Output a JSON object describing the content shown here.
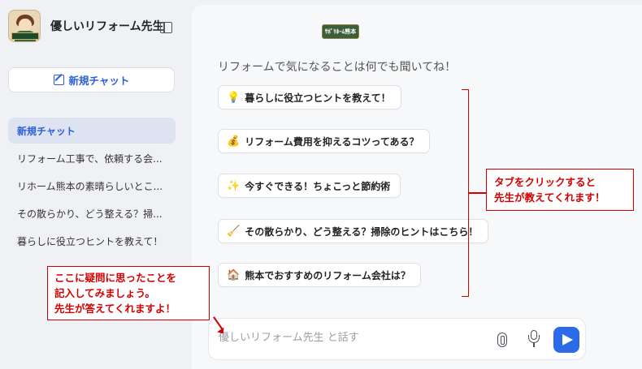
{
  "sidebar": {
    "title": "優しいリフォーム先生",
    "new_chat_label": "新規チャット",
    "history": [
      {
        "label": "新規チャット",
        "active": true
      },
      {
        "label": "リフォーム工事で、依頼する会..."
      },
      {
        "label": "リホーム熊本の素晴らしいとこ..."
      },
      {
        "label": "その散らかり、どう整える？掃..."
      },
      {
        "label": "暮らしに役立つヒントを教えて！"
      }
    ]
  },
  "main": {
    "logo_text": "ｻﾎﾟﾘﾎｰﾑ熊本",
    "greeting": "リフォームで気になることは何でも聞いてね！",
    "suggestions": [
      {
        "icon": "lightbulb-icon",
        "emoji": "💡",
        "label": "暮らしに役立つヒントを教えて！"
      },
      {
        "icon": "money-bag-icon",
        "emoji": "💰",
        "label": "リフォーム費用を抑えるコツってある？"
      },
      {
        "icon": "sparkles-icon",
        "emoji": "✨",
        "label": "今すぐできる！ちょこっと節約術"
      },
      {
        "icon": "broom-icon",
        "emoji": "🧹",
        "label": "その散らかり、どう整える？掃除のヒントはこちら！"
      },
      {
        "icon": "house-icon",
        "emoji": "🏠",
        "label": "熊本でおすすめのリフォーム会社は？"
      }
    ],
    "input_placeholder": "優しいリフォーム先生 と話す"
  },
  "annotations": {
    "left_callout": [
      "ここに疑問に思ったことを",
      "記入してみましょう。",
      "先生が答えてくれますよ！"
    ],
    "right_callout": [
      "タブをクリックすると",
      "先生が教えてくれます！"
    ]
  },
  "colors": {
    "accent": "#2b6be8",
    "annotation": "#d40000"
  }
}
